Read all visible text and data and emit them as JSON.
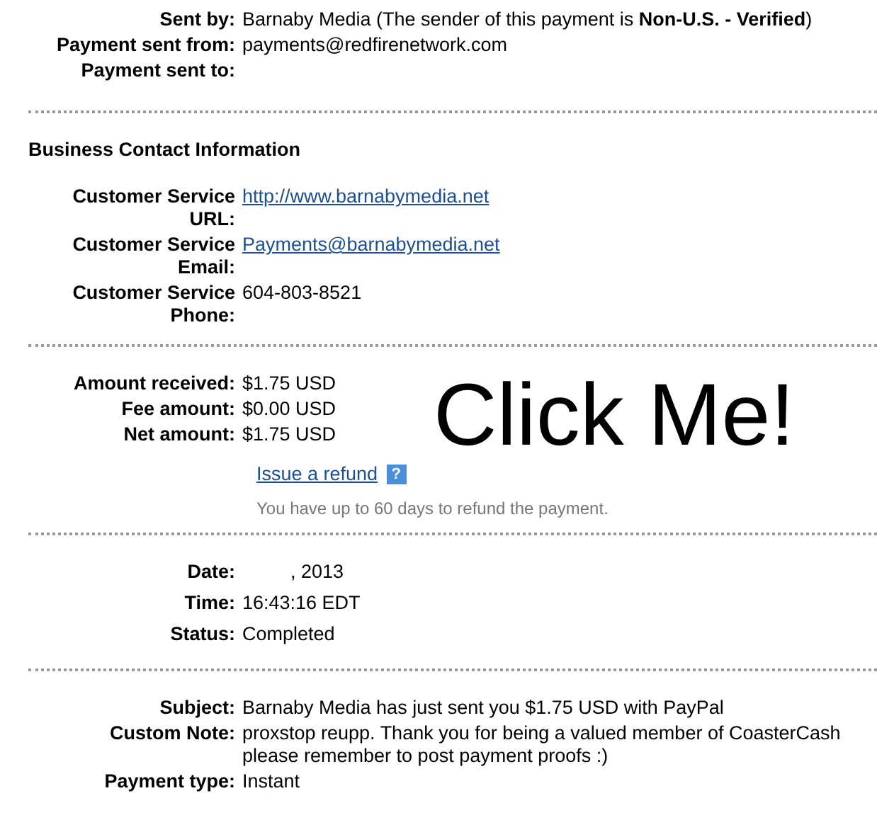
{
  "sections": [
    {
      "rows": [
        {
          "label": "Sent by:",
          "kind": "text",
          "value": "Barnaby Media (The sender of this payment is **Non-U.S. - Verified**)"
        },
        {
          "label": "Payment sent from:",
          "kind": "text",
          "value": "payments@redfirenetwork.com"
        },
        {
          "label": "Payment sent to:",
          "kind": "empty"
        }
      ]
    },
    {
      "heading": "Business Contact Information",
      "rows": [
        {
          "label": "Customer Service URL:",
          "kind": "link",
          "value": "http://www.barnabymedia.net"
        },
        {
          "label": "Customer Service Email:",
          "kind": "link",
          "value": "Payments@barnabymedia.net"
        },
        {
          "label": "Customer Service Phone:",
          "kind": "text",
          "value": "604-803-8521"
        }
      ]
    },
    {
      "banner": "Click Me!",
      "rows": [
        {
          "label": "Amount received:",
          "kind": "text",
          "value": "$1.75 USD"
        },
        {
          "label": "Fee amount:",
          "kind": "text",
          "value": "$0.00 USD"
        },
        {
          "label": "Net amount:",
          "kind": "text",
          "value": "$1.75 USD"
        }
      ],
      "refund": {
        "link": "Issue a refund",
        "help": "?",
        "note": "You have up to 60 days to refund the payment."
      }
    },
    {
      "rows": [
        {
          "label": "Date:",
          "kind": "date",
          "value": ", 2013"
        },
        {
          "label": "Time:",
          "kind": "text",
          "value": "16:43:16 EDT"
        },
        {
          "label": "Status:",
          "kind": "text",
          "value": "Completed"
        }
      ]
    },
    {
      "rows": [
        {
          "label": "Subject:",
          "kind": "text",
          "value": "Barnaby Media has just sent you $1.75 USD with PayPal"
        },
        {
          "label": "Custom Note:",
          "kind": "text",
          "value": "proxstop reupp. Thank you for being a valued member of CoasterCash please remember to post payment proofs :)"
        },
        {
          "label": "Payment type:",
          "kind": "text",
          "value": "Instant"
        }
      ]
    }
  ]
}
